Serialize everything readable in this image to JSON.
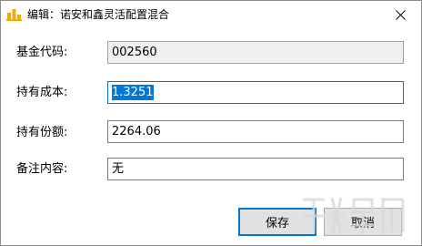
{
  "window": {
    "title": "编辑：诺安和鑫灵活配置混合"
  },
  "fields": [
    {
      "label": "基金代码:",
      "value": "002560"
    },
    {
      "label": "持有成本:",
      "value": "1.3251"
    },
    {
      "label": "持有份额:",
      "value": "2264.06"
    },
    {
      "label": "备注内容:",
      "value": "无"
    }
  ],
  "buttons": {
    "save_label": "保存",
    "cancel_label": "取消"
  },
  "colors": {
    "accent": "#0078d7",
    "button_face": "#e1e1e1",
    "readonly_bg": "#f0f0f0"
  }
}
